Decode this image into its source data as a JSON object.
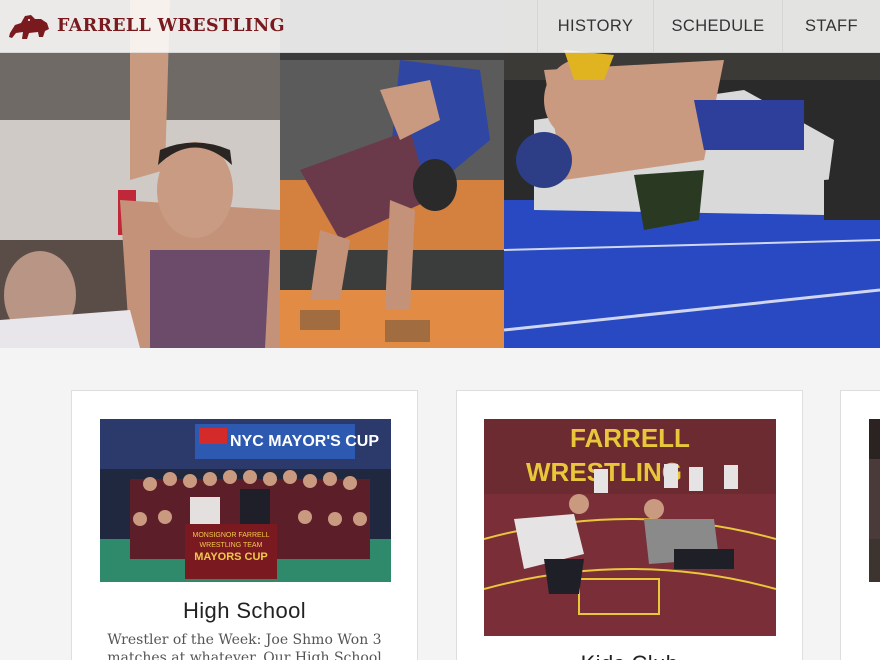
{
  "header": {
    "brand_name": "FARRELL WRESTLING",
    "logo_icon": "lion-icon",
    "brand_color": "#7a1a1f"
  },
  "nav": {
    "items": [
      {
        "label": "HISTORY"
      },
      {
        "label": "SCHEDULE"
      },
      {
        "label": "STAFF"
      }
    ]
  },
  "hero": {
    "panels": [
      {
        "subject": "wrestler raising arm in victory"
      },
      {
        "subject": "two wrestlers grappling standing"
      },
      {
        "subject": "wrestlers on mat"
      }
    ]
  },
  "cards": [
    {
      "title": "High School",
      "text": "Wrestler of the Week: Joe Shmo Won 3 matches at whatever. Our High School team",
      "photo": {
        "banner_text": "NYC MAYOR'S CUP",
        "sign_text_1": "MONSIGNOR FARRELL",
        "sign_text_2": "WRESTLING TEAM",
        "sign_text_3": "MAYORS CUP"
      }
    },
    {
      "title": "Kids Club",
      "photo": {
        "wall_text_1": "FARRELL",
        "wall_text_2": "WRESTLING"
      }
    },
    {
      "title": "",
      "text": ""
    }
  ]
}
